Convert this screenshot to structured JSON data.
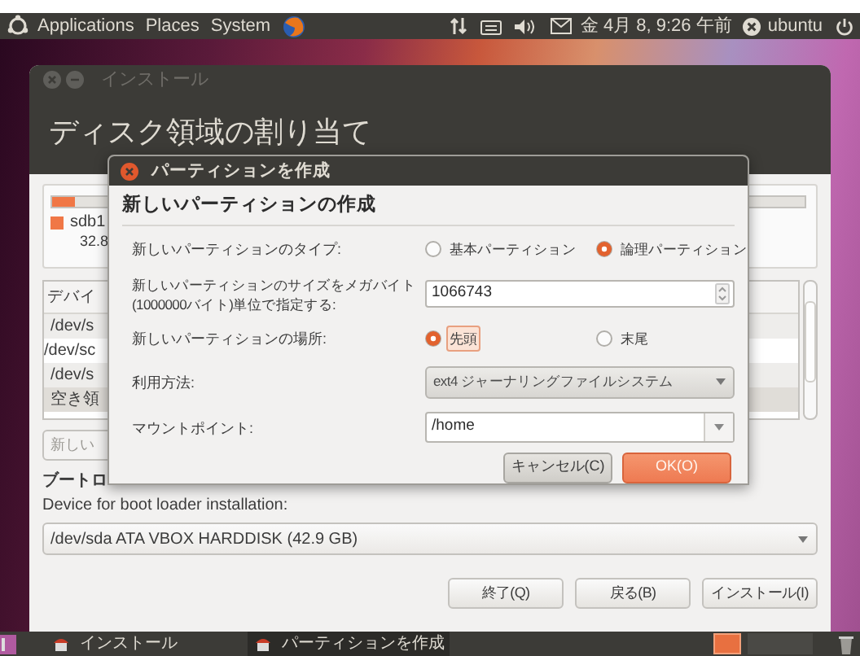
{
  "top_panel": {
    "menus": [
      "Applications",
      "Places",
      "System"
    ],
    "clock": "金 4月 8, 9:26 午前",
    "user": "ubuntu"
  },
  "install_window": {
    "title": "インストール",
    "heading": "ディスク領域の割り当て",
    "legend": [
      {
        "name": "sdb1",
        "size": "32.8",
        "color": "#f07746"
      }
    ],
    "table": {
      "column_1": "デバイ",
      "rows": [
        {
          "cell": "/dev/s",
          "selected": false
        },
        {
          "cell": "/dev/sc",
          "selected": false
        },
        {
          "cell": "/dev/s",
          "selected": false
        },
        {
          "cell": "空き領",
          "selected": true
        }
      ]
    },
    "new_partition_button": "新しい",
    "bootloader_heading": "ブートロ",
    "bootloader_label": "Device for boot loader installation:",
    "bootloader_device": "/dev/sda ATA VBOX HARDDISK (42.9 GB)",
    "buttons": [
      "終了(Q)",
      "戻る(B)",
      "インストール(I)"
    ]
  },
  "dialog": {
    "title": "パーティションを作成",
    "heading": "新しいパーティションの作成",
    "type": {
      "label": "新しいパーティションのタイプ:",
      "options": [
        {
          "label": "基本パーティション",
          "selected": false,
          "focused": false
        },
        {
          "label": "論理パーティション",
          "selected": true,
          "focused": false
        }
      ]
    },
    "size": {
      "label_lines": [
        "新しいパーティションのサイズをメガバイト",
        "(1000000バイト)単位で指定する:"
      ],
      "value": "1066743"
    },
    "location": {
      "label": "新しいパーティションの場所:",
      "options": [
        {
          "label": "先頭",
          "selected": true,
          "focused": true
        },
        {
          "label": "末尾",
          "selected": false,
          "focused": false
        }
      ]
    },
    "usage": {
      "label": "利用方法:",
      "value": "ext4 ジャーナリングファイルシステム"
    },
    "mount_point": {
      "label": "マウントポイント:",
      "value": "/home"
    },
    "buttons": [
      {
        "label": "キャンセル(C)",
        "kind": "default"
      },
      {
        "label": "OK(O)",
        "kind": "primary"
      }
    ]
  },
  "taskbar": {
    "tasks": [
      {
        "label": "インストール",
        "selected": false
      },
      {
        "label": "パーティションを作成",
        "selected": true
      }
    ]
  }
}
